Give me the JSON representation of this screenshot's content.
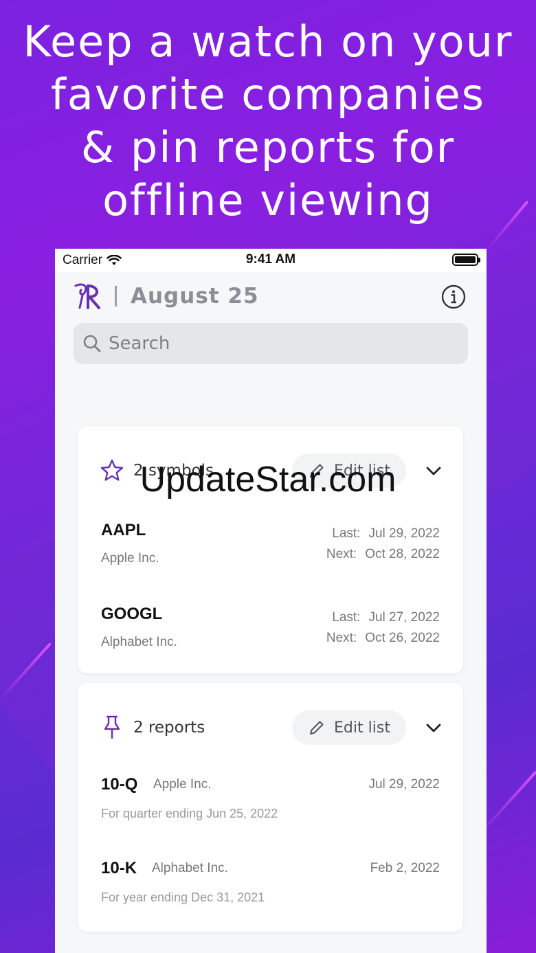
{
  "headline": {
    "line1": "Keep a watch on your",
    "line2": "favorite companies",
    "line3": "& pin reports for",
    "line4": "offline viewing"
  },
  "status_bar": {
    "carrier": "Carrier",
    "time": "9:41 AM"
  },
  "header": {
    "date": "August 25"
  },
  "search": {
    "placeholder": "Search"
  },
  "watchlist": {
    "label": "2 symbols",
    "edit_label": "Edit list",
    "last_label": "Last:",
    "next_label": "Next:",
    "items": [
      {
        "symbol": "AAPL",
        "company": "Apple Inc.",
        "last": "Jul 29, 2022",
        "next": "Oct 28, 2022"
      },
      {
        "symbol": "GOOGL",
        "company": "Alphabet Inc.",
        "last": "Jul 27, 2022",
        "next": "Oct 26, 2022"
      }
    ]
  },
  "pinned": {
    "label": "2 reports",
    "edit_label": "Edit list",
    "items": [
      {
        "form": "10-Q",
        "company": "Apple Inc.",
        "date": "Jul 29, 2022",
        "period": "For quarter ending Jun 25, 2022"
      },
      {
        "form": "10-K",
        "company": "Alphabet Inc.",
        "date": "Feb 2, 2022",
        "period": "For year ending Dec 31, 2021"
      }
    ]
  },
  "watermark": "UpdateStar.com",
  "colors": {
    "accent": "#6a2fb0",
    "background_purple": "#7b22e0"
  },
  "icons": {
    "watch": "star-icon",
    "pin": "pin-icon",
    "edit": "pencil-icon",
    "collapse": "chevron-down-icon",
    "info": "info-icon",
    "search": "search-icon"
  }
}
